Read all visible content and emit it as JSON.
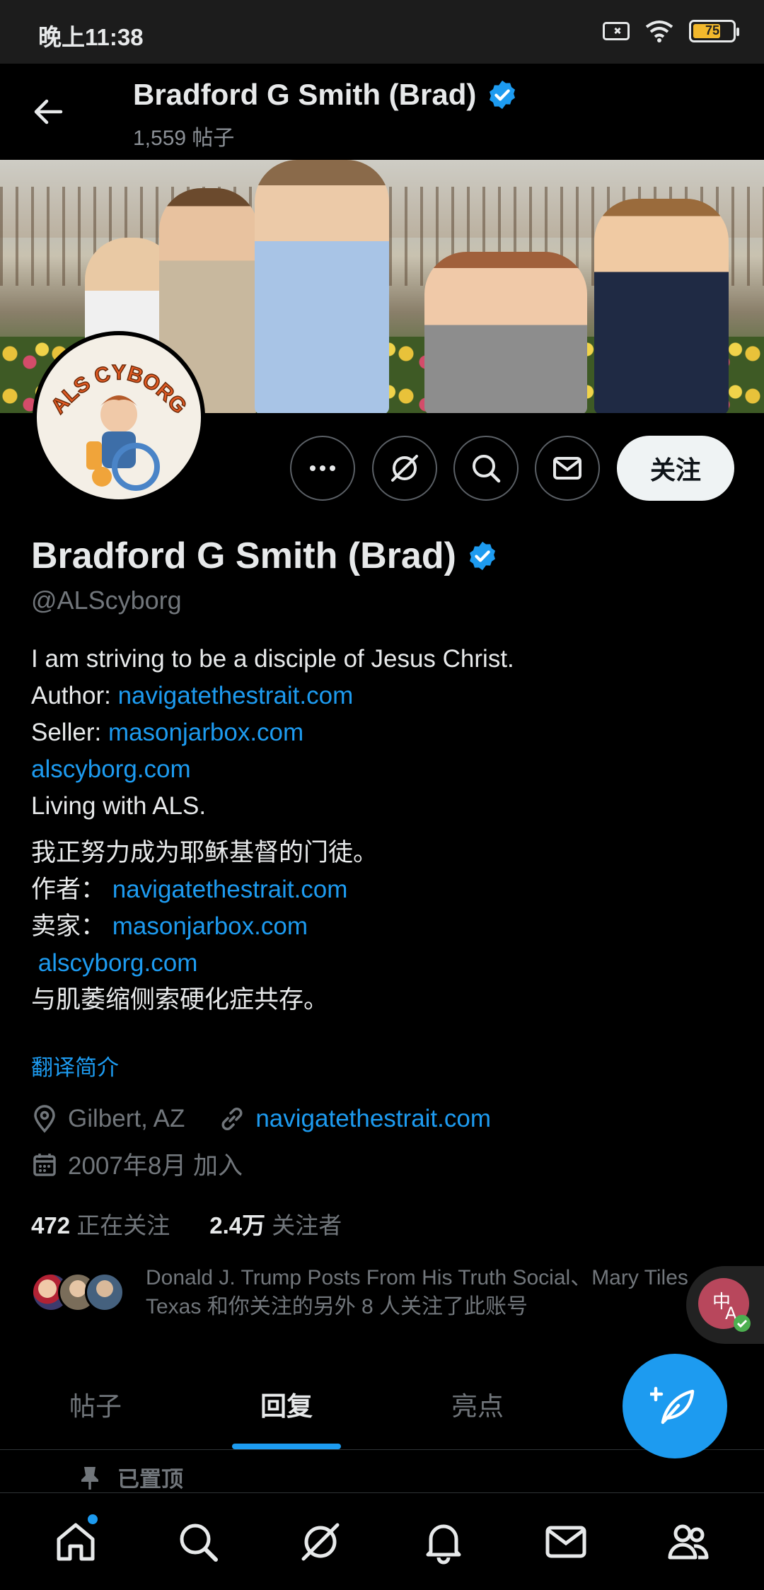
{
  "status_bar": {
    "time": "晚上11:38",
    "battery": "75"
  },
  "header": {
    "title": "Bradford G Smith (Brad)",
    "post_count": "1,559 帖子"
  },
  "avatar": {
    "badge_text": "ALS CYBORG"
  },
  "actions": {
    "follow_label": "关注"
  },
  "profile": {
    "name": "Bradford G Smith (Brad)",
    "handle": "@ALScyborg",
    "bio": {
      "line1": "I am striving to be a disciple of Jesus Christ.",
      "author_label": "Author: ",
      "author_link": "navigatethestrait.com",
      "seller_label": "Seller: ",
      "seller_link": "masonjarbox.com",
      "site_link": "alscyborg.com",
      "line5": "Living with ALS.",
      "zh_line1": "我正努力成为耶稣基督的门徒。",
      "zh_author_label": "作者：",
      "zh_author_link": "navigatethestrait.com",
      "zh_seller_label": "卖家：",
      "zh_seller_link": "masonjarbox.com",
      "zh_site_link": "alscyborg.com",
      "zh_line5": "与肌萎缩侧索硬化症共存。"
    },
    "translate_bio": "翻译简介",
    "location": "Gilbert, AZ",
    "website": "navigatethestrait.com",
    "joined": "2007年8月 加入",
    "following_count": "472",
    "following_label": "正在关注",
    "followers_count": "2.4万",
    "followers_label": "关注者",
    "followed_by_text": "Donald J. Trump Posts From His Truth Social、Mary Tiles Texas 和你关注的另外 8 人关注了此账号"
  },
  "tabs": [
    {
      "label": "帖子"
    },
    {
      "label": "回复"
    },
    {
      "label": "亮点"
    },
    {
      "label": ""
    }
  ],
  "pinned_label": "已置顶",
  "colors": {
    "accent": "#1d9bf0",
    "background": "#000000",
    "text": "#e7e9ea",
    "muted": "#71767b"
  }
}
